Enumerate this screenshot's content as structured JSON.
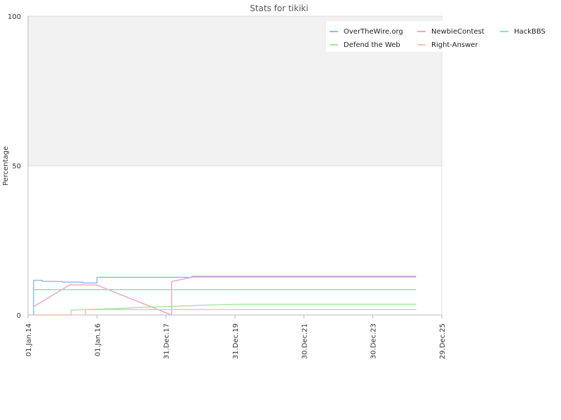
{
  "chart_data": {
    "type": "line",
    "title": "Stats for tikiki",
    "xlabel": "",
    "ylabel": "Percentage",
    "ylim": [
      0,
      100
    ],
    "y_ticks": [
      "0",
      "50",
      "100"
    ],
    "x_tick_labels": [
      "01.Jan.14",
      "01.Jan.16",
      "31.Dec.17",
      "31.Dec.19",
      "30.Dec.21",
      "30.Dec.23",
      "29.Dec.25"
    ],
    "xlim": [
      "2014-01-01",
      "2025-12-29"
    ],
    "grid": true,
    "legend_position": "top-right",
    "series": [
      {
        "name": "OverTheWire.org",
        "color": "#90bfea",
        "points": [
          [
            "2014-03-01",
            0
          ],
          [
            "2014-03-01",
            11.6
          ],
          [
            "2014-06-01",
            11.6
          ],
          [
            "2014-06-01",
            11.3
          ],
          [
            "2015-01-01",
            11.2
          ],
          [
            "2015-01-01",
            11.0
          ],
          [
            "2015-08-01",
            11.0
          ],
          [
            "2015-08-01",
            10.7
          ],
          [
            "2016-01-01",
            10.7
          ],
          [
            "2016-01-01",
            12.6
          ],
          [
            "2018-10-01",
            12.6
          ],
          [
            "2018-10-01",
            12.7
          ],
          [
            "2025-04-01",
            12.7
          ]
        ]
      },
      {
        "name": "NewbieContest",
        "color": "#f0a6cc",
        "points": [
          [
            "2014-03-01",
            2.8
          ],
          [
            "2015-04-01",
            10.3
          ],
          [
            "2015-04-01",
            10.1
          ],
          [
            "2016-01-01",
            10.0
          ],
          [
            "2018-03-01",
            0
          ],
          [
            "2018-03-01",
            11.2
          ],
          [
            "2018-10-01",
            12.6
          ],
          [
            "2018-10-01",
            13.0
          ],
          [
            "2025-04-01",
            13.0
          ]
        ]
      },
      {
        "name": "HackBBS",
        "color": "#8ee0bc",
        "points": [
          [
            "2014-03-01",
            8.5
          ],
          [
            "2025-04-01",
            8.5
          ]
        ]
      },
      {
        "name": "Defend the Web",
        "color": "#a9e6a3",
        "points": [
          [
            "2014-03-01",
            0
          ],
          [
            "2015-04-01",
            0
          ],
          [
            "2015-04-01",
            1.6
          ],
          [
            "2015-08-01",
            1.8
          ],
          [
            "2016-03-01",
            2.0
          ],
          [
            "2016-09-01",
            2.2
          ],
          [
            "2017-03-01",
            2.5
          ],
          [
            "2018-01-01",
            2.8
          ],
          [
            "2018-09-01",
            3.1
          ],
          [
            "2019-06-01",
            3.4
          ],
          [
            "2020-03-01",
            3.6
          ],
          [
            "2025-04-01",
            3.6
          ]
        ]
      },
      {
        "name": "Right-Answer",
        "color": "#f4c4b6",
        "points": [
          [
            "2014-03-01",
            0
          ],
          [
            "2015-09-01",
            0
          ],
          [
            "2015-09-01",
            1.8
          ],
          [
            "2025-04-01",
            1.8
          ]
        ]
      }
    ]
  }
}
